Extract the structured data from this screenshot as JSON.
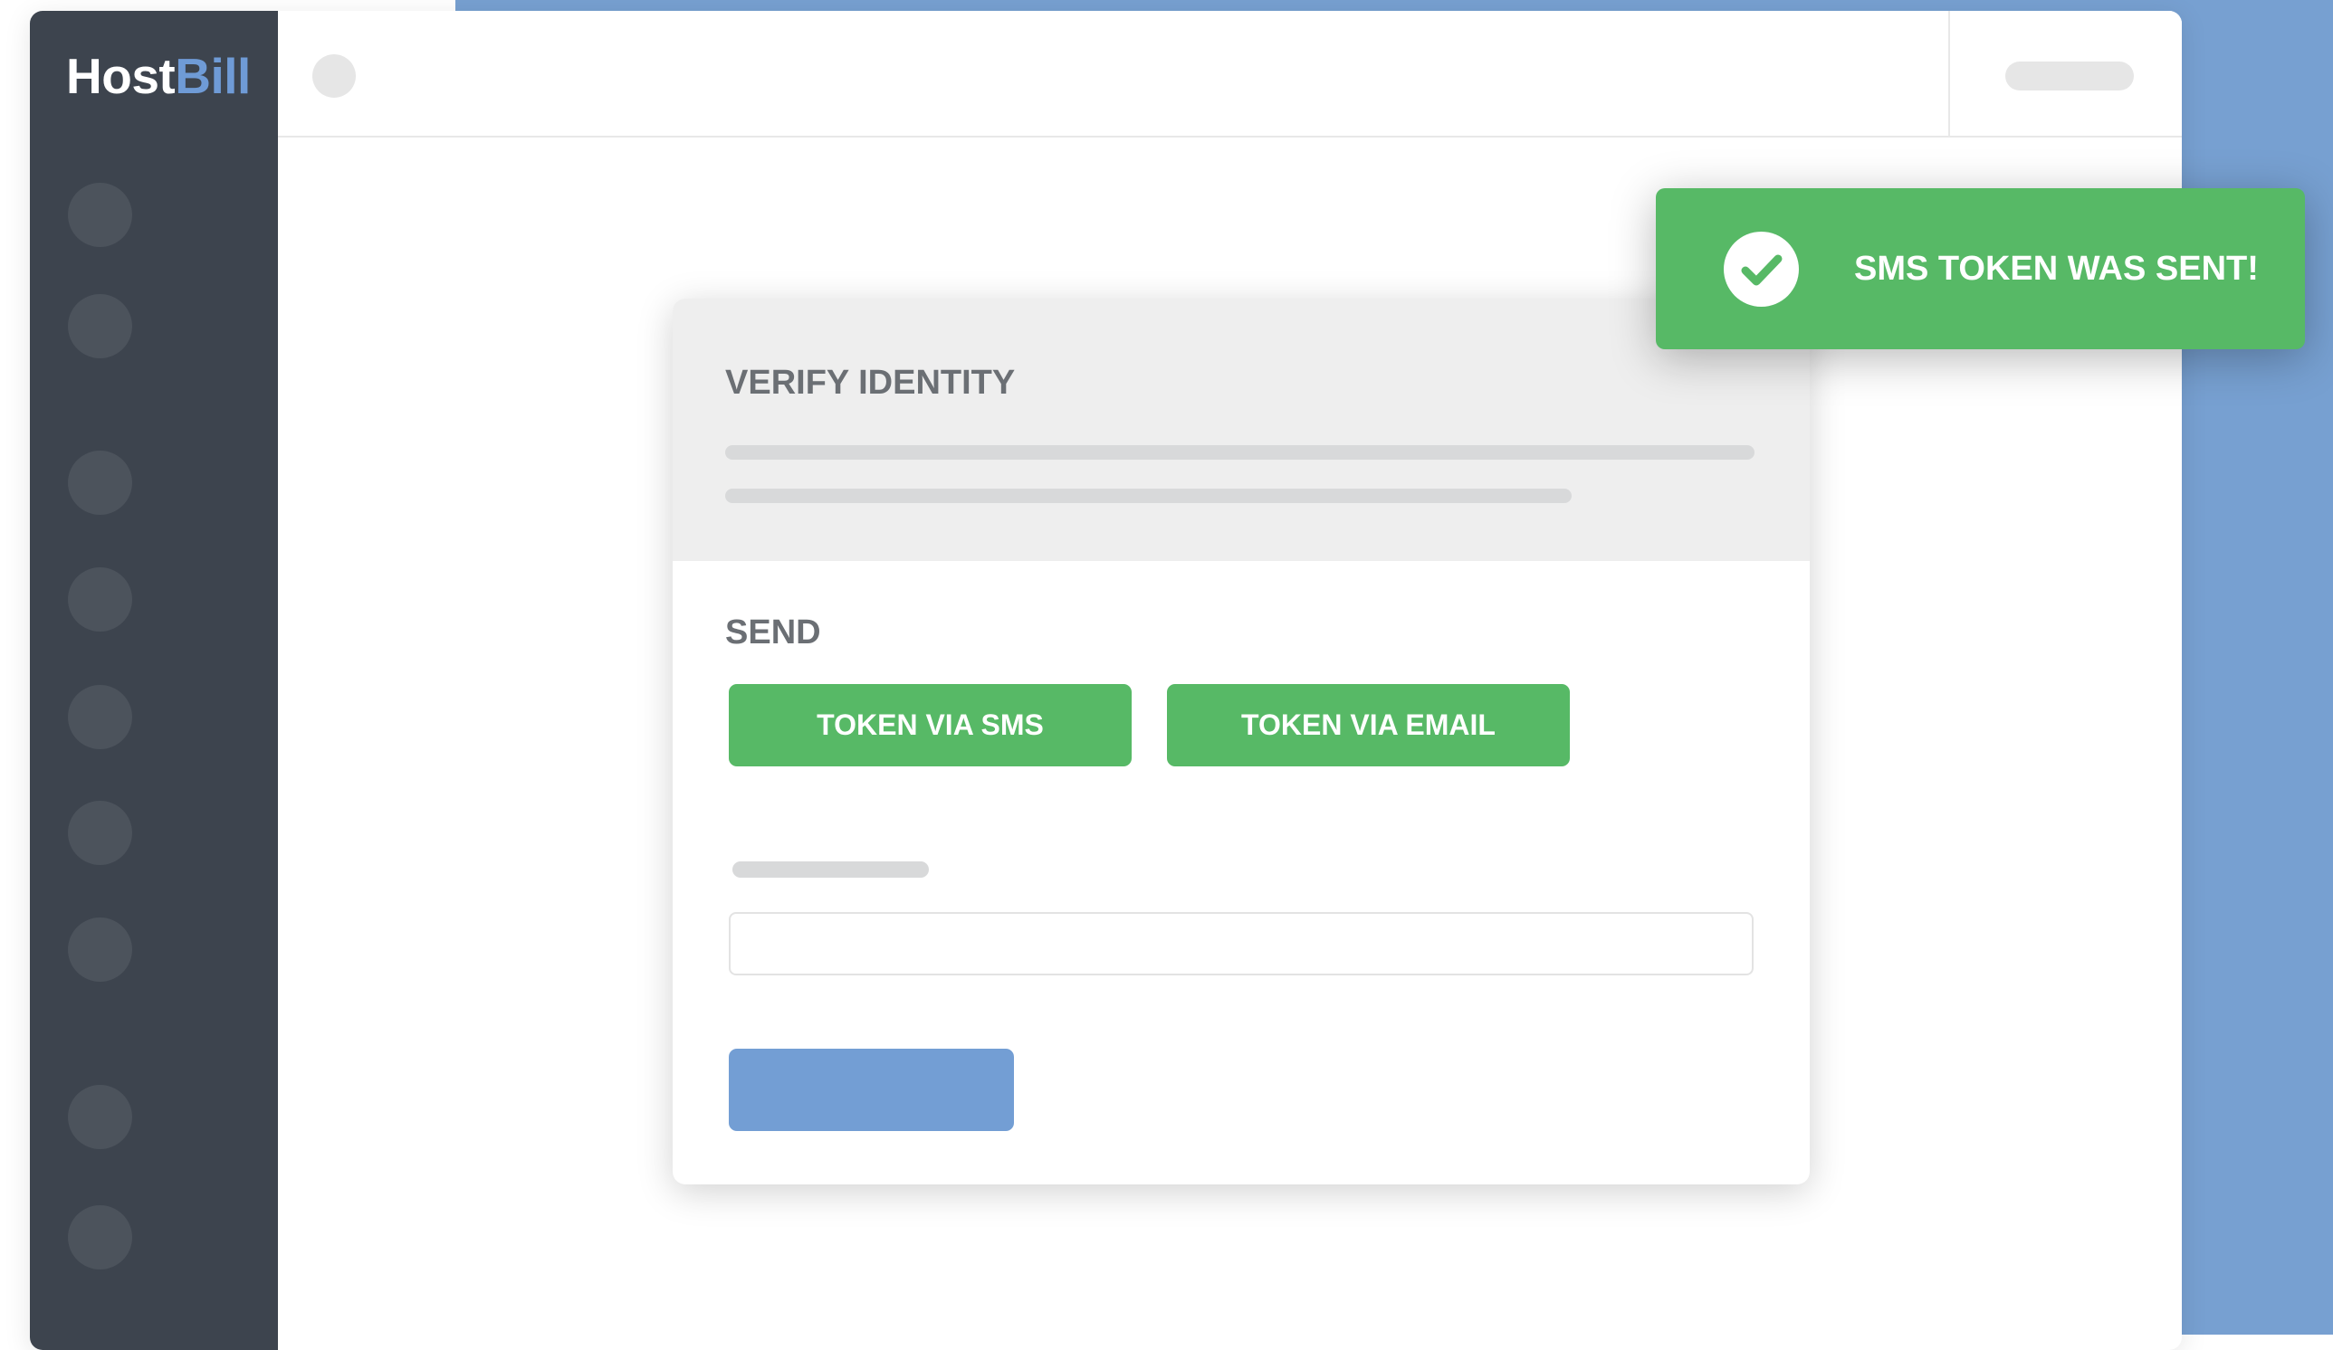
{
  "brand": {
    "name_part1": "Host",
    "name_part2": "Bill"
  },
  "card": {
    "title": "VERIFY IDENTITY",
    "send_label": "SEND",
    "buttons": {
      "sms": "TOKEN VIA SMS",
      "email": "TOKEN VIA EMAIL"
    },
    "token_input": {
      "value": "",
      "placeholder": ""
    }
  },
  "toast": {
    "message": "SMS TOKEN WAS SENT!",
    "icon": "check-circle-icon"
  },
  "colors": {
    "sidebar": "#3d444e",
    "success_green": "#57b966",
    "primary_blue": "#739ed4",
    "background_blue": "#77a0d1"
  }
}
